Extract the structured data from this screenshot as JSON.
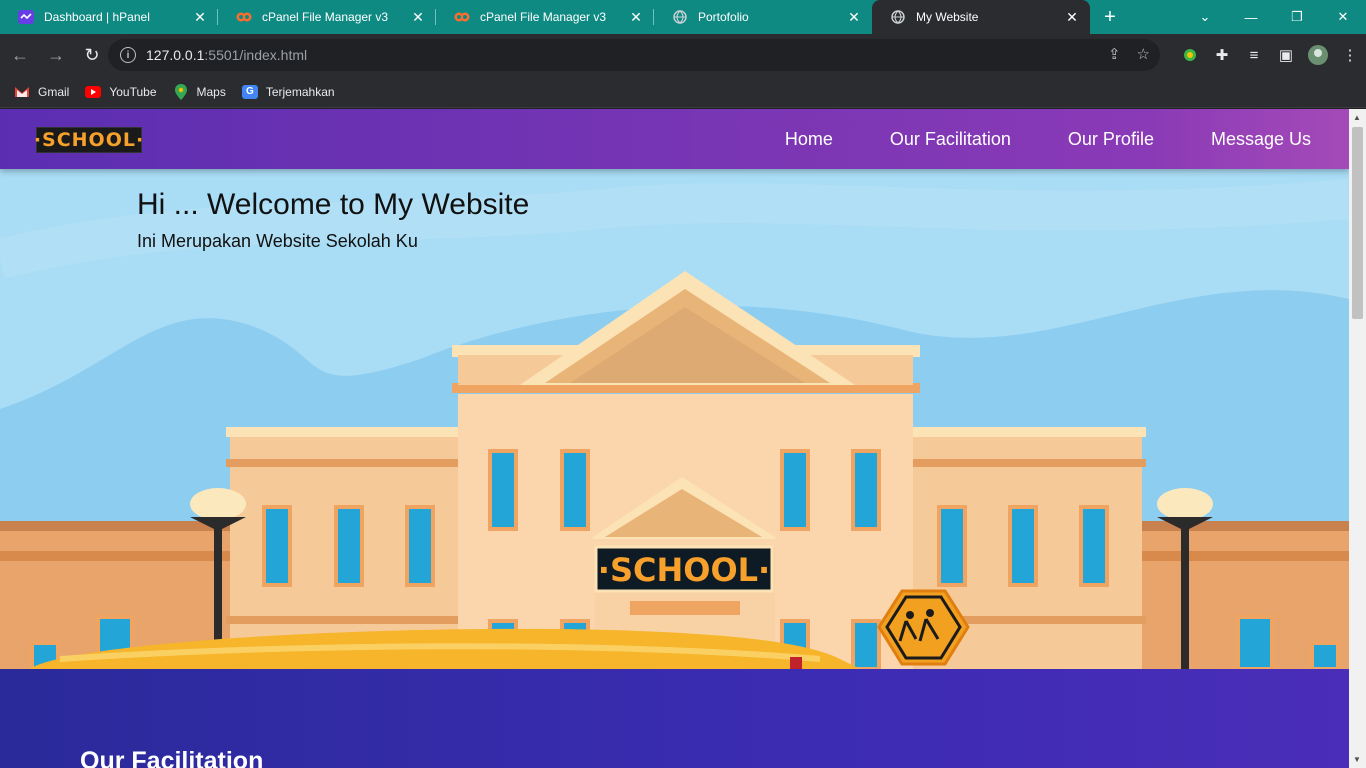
{
  "browser": {
    "tabs": [
      {
        "title": "Dashboard | hPanel",
        "icon": "hpanel-icon"
      },
      {
        "title": "cPanel File Manager v3",
        "icon": "cpanel-icon"
      },
      {
        "title": "cPanel File Manager v3",
        "icon": "cpanel-icon"
      },
      {
        "title": "Portofolio",
        "icon": "globe-icon"
      },
      {
        "title": "My Website",
        "icon": "globe-icon"
      }
    ],
    "active_tab": 4,
    "address": {
      "host": "127.0.0.1",
      "path": ":5501/index.html"
    },
    "bookmarks": [
      "Gmail",
      "YouTube",
      "Maps",
      "Terjemahkan"
    ],
    "colors": {
      "tabstrip": "#0f8a83",
      "toolbar": "#2b2c2f"
    }
  },
  "site": {
    "logo": "·SCHOOL·",
    "nav": [
      "Home",
      "Our Facilitation",
      "Our Profile",
      "Message Us"
    ],
    "hero": {
      "title": "Hi ... Welcome to My Website",
      "subtitle": "Ini Merupakan Website Sekolah Ku",
      "sign": "·SCHOOL·"
    },
    "section_title": "Our Facilitation",
    "colors": {
      "nav_start": "#5b2eb1",
      "nav_end": "#a54ab8",
      "sky": "#a9dcf5",
      "section": "#3c2cb3"
    }
  }
}
